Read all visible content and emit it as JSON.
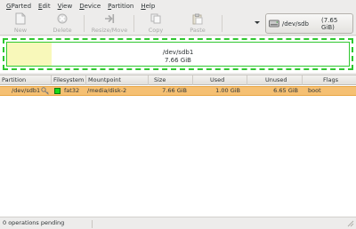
{
  "menubar": {
    "items": [
      {
        "label": "GParted",
        "u": "G",
        "rest": "Parted"
      },
      {
        "label": "Edit",
        "u": "E",
        "rest": "dit"
      },
      {
        "label": "View",
        "u": "V",
        "rest": "iew"
      },
      {
        "label": "Device",
        "u": "D",
        "rest": "evice"
      },
      {
        "label": "Partition",
        "u": "P",
        "rest": "artition"
      },
      {
        "label": "Help",
        "u": "H",
        "rest": "elp"
      }
    ]
  },
  "toolbar": {
    "new_label": "New",
    "delete_label": "Delete",
    "resize_label": "Resize/Move",
    "copy_label": "Copy",
    "paste_label": "Paste",
    "disabled_color": "#a9a9a9"
  },
  "device": {
    "name": "/dev/sdb",
    "size": "(7.65 GiB)"
  },
  "graph": {
    "path": "/dev/sdb1",
    "size": "7.66 GiB",
    "used_fraction": 0.13,
    "border_color": "#2fc82f",
    "used_color": "#f8f8ba"
  },
  "table": {
    "headers": {
      "partition": "Partition",
      "filesystem": "Filesystem",
      "mountpoint": "Mountpoint",
      "size": "Size",
      "used": "Used",
      "unused": "Unused",
      "flags": "Flags"
    },
    "rows": [
      {
        "partition": "/dev/sdb1",
        "filesystem": "fat32",
        "fs_color": "#18d918",
        "mountpoint": "/media/disk-2",
        "size": "7.66 GiB",
        "used": "1.00 GiB",
        "unused": "6.65 GiB",
        "flags": "boot",
        "selected": true,
        "selection_color": "#f5c073"
      }
    ]
  },
  "status": {
    "text": "0 operations pending"
  }
}
